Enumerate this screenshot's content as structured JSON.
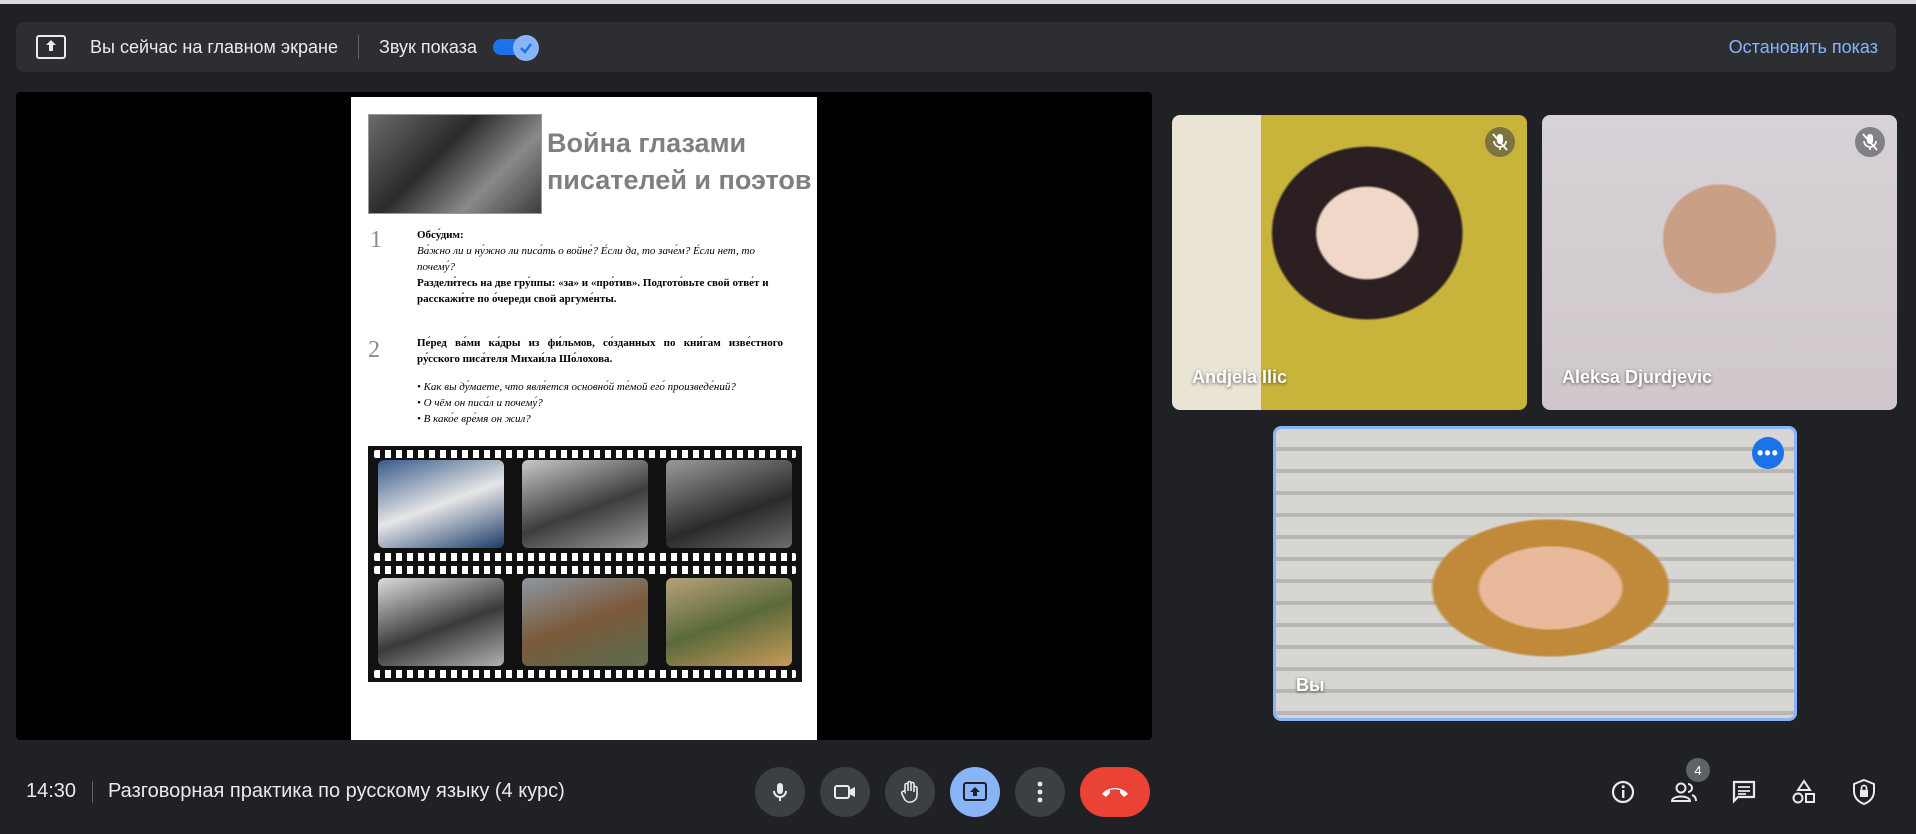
{
  "banner": {
    "main_screen_text": "Вы сейчас на главном экране",
    "sound_label": "Звук показа",
    "sound_on": true,
    "stop_label": "Остановить показ",
    "icon": "present-screen-icon"
  },
  "slide": {
    "title": "Война глазами писателей и поэтов",
    "section1_number": "1",
    "section1_heading": "Обсу́дим:",
    "section1_question": "Ва́жно ли и ну́жно ли писа́ть о войне́? Е́сли да, то заче́м? Е́сли нет, то почему́?",
    "section1_task": "Раздели́тесь на две гру́ппы: «за» и «про́тив». Подгото́вьте свой отве́т и расскажи́те по о́череди свой аргуме́нты.",
    "section2_number": "2",
    "section2_intro": "Пе́ред ва́ми ка́дры из фи́льмов, со́зданных по кни́гам изве́стного ру́сского писа́теля Михаи́ла Шо́лохова.",
    "section2_q1": "• Как вы ду́маете, что явля́ется основно́й те́мой его́ произведе́ний?",
    "section2_q2": "• О чём он писа́л и почему́?",
    "section2_q3": "• В како́е вре́мя он жил?"
  },
  "participants": [
    {
      "name": "Andjela Ilic",
      "muted": true
    },
    {
      "name": "Aleksa Djurdjevic",
      "muted": true
    },
    {
      "name": "Вы",
      "muted": false
    }
  ],
  "bottom": {
    "time": "14:30",
    "meeting_title": "Разговорная практика по русскому языку (4 курс)",
    "participants_count": "4"
  },
  "colors": {
    "accent": "#8ab4f8",
    "end_call": "#ea4335",
    "background": "#202124"
  }
}
